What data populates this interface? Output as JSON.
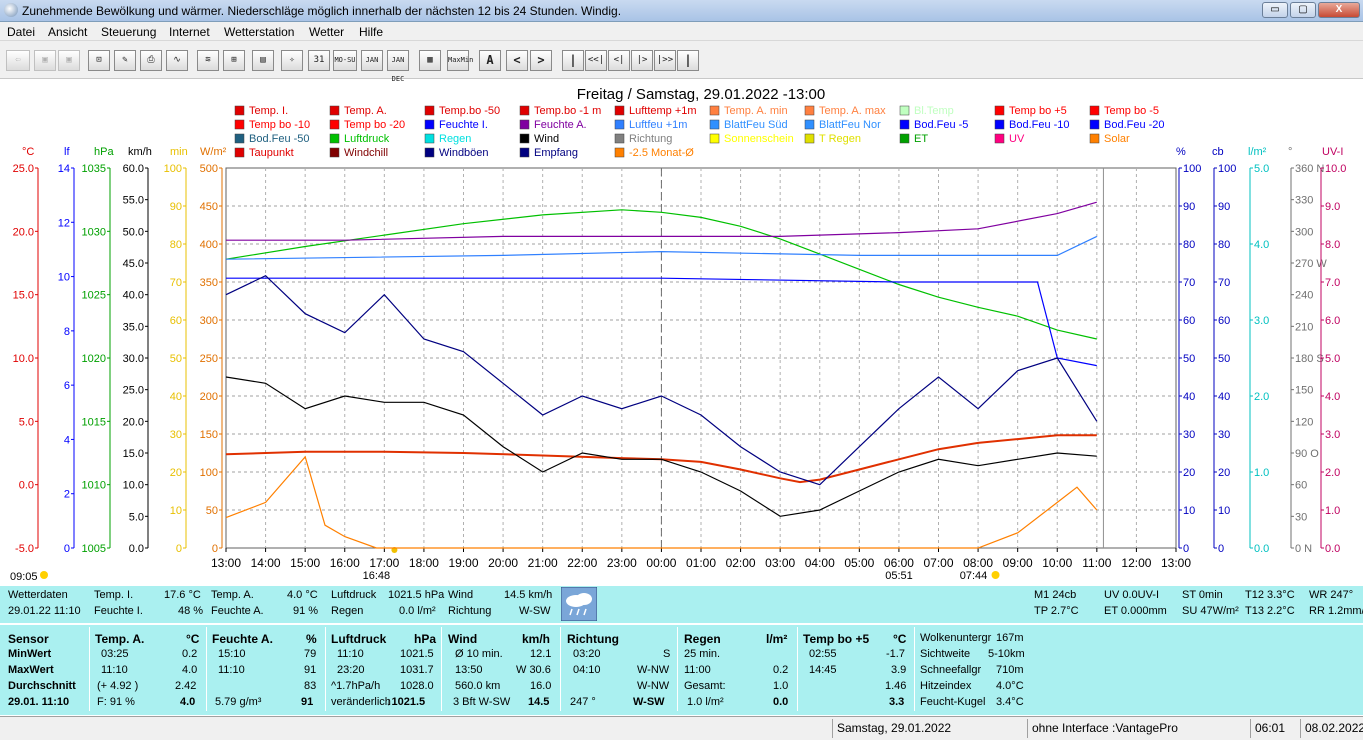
{
  "window": {
    "title": "Zunehmende Bewölkung und wärmer. Niederschläge möglich innerhalb der nächsten 12 bis 24 Stunden. Windig.",
    "buttons": [
      "▭",
      "▢",
      "X"
    ]
  },
  "menu": [
    "Datei",
    "Ansicht",
    "Steuerung",
    "Internet",
    "Wetterstation",
    "Wetter",
    "Hilfe"
  ],
  "toolbar": {
    "buttons": [
      {
        "name": "back",
        "label": "⇦",
        "dim": true
      },
      {
        "name": "save",
        "label": "▣",
        "dim": true
      },
      {
        "name": "save-all",
        "label": "▣",
        "dim": true
      },
      {
        "name": "graph",
        "label": "⊡"
      },
      {
        "name": "notes",
        "label": "✎"
      },
      {
        "name": "print",
        "label": "⎙"
      },
      {
        "name": "curve",
        "label": "∿"
      },
      {
        "name": "chart2",
        "label": "≋"
      },
      {
        "name": "chart3",
        "label": "⊞"
      },
      {
        "name": "doc",
        "label": "▤"
      },
      {
        "name": "compass",
        "label": "✧"
      },
      {
        "name": "day",
        "label": "31"
      },
      {
        "name": "week",
        "label": "MO-SU"
      },
      {
        "name": "month",
        "label": "JAN"
      },
      {
        "name": "year",
        "label": "JAN DEC"
      },
      {
        "name": "table",
        "label": "▦"
      },
      {
        "name": "minmax",
        "label": "MaxMin"
      },
      {
        "name": "auto",
        "label": "A"
      },
      {
        "name": "prev",
        "label": "<"
      },
      {
        "name": "next",
        "label": ">"
      },
      {
        "name": "first",
        "label": "|"
      },
      {
        "name": "rew-fast",
        "label": "<<|"
      },
      {
        "name": "rew",
        "label": "<|"
      },
      {
        "name": "fwd",
        "label": "|>"
      },
      {
        "name": "fwd-fast",
        "label": "|>>"
      },
      {
        "name": "last",
        "label": "|"
      }
    ]
  },
  "chart_data": {
    "type": "line",
    "title": "Freitag / Samstag, 29.01.2022  -13:00",
    "x_ticks": [
      "13:00",
      "14:00",
      "15:00",
      "16:00",
      "17:00",
      "18:00",
      "19:00",
      "20:00",
      "21:00",
      "22:00",
      "23:00",
      "00:00",
      "01:00",
      "02:00",
      "03:00",
      "04:00",
      "05:00",
      "06:00",
      "07:00",
      "08:00",
      "09:00",
      "10:00",
      "11:00",
      "12:00",
      "13:00"
    ],
    "x_markers": {
      "sunset": "16:48",
      "sunrise_twilight": "05:51",
      "sunrise": "07:44",
      "left": "09:05"
    },
    "grid": true,
    "legend_placement": "top",
    "left_axes": [
      {
        "unit": "°C",
        "color": "#e00000",
        "ticks": [
          "25.0",
          "20.0",
          "15.0",
          "10.0",
          "5.0",
          "0.0",
          "-5.0"
        ]
      },
      {
        "unit": "lf",
        "color": "#0000ff",
        "ticks": [
          "14",
          "12",
          "10",
          "8",
          "6",
          "4",
          "2",
          "0"
        ]
      },
      {
        "unit": "hPa",
        "color": "#00a000",
        "ticks": [
          "1035",
          "1030",
          "1025",
          "1020",
          "1015",
          "1010",
          "1005"
        ]
      },
      {
        "unit": "km/h",
        "color": "#000000",
        "ticks": [
          "60.0",
          "55.0",
          "50.0",
          "45.0",
          "40.0",
          "35.0",
          "30.0",
          "25.0",
          "20.0",
          "15.0",
          "10.0",
          "5.0",
          "0.0"
        ]
      },
      {
        "unit": "min",
        "color": "#e8c000",
        "ticks": [
          "100",
          "90",
          "80",
          "70",
          "60",
          "50",
          "40",
          "30",
          "20",
          "10",
          "0"
        ]
      },
      {
        "unit": "W/m²",
        "color": "#e07000",
        "ticks": [
          "500",
          "450",
          "400",
          "350",
          "300",
          "250",
          "200",
          "150",
          "100",
          "50",
          "0"
        ]
      }
    ],
    "right_axes": [
      {
        "unit": "%",
        "color": "#0000c0",
        "ticks": [
          "100",
          "90",
          "80",
          "70",
          "60",
          "50",
          "40",
          "30",
          "20",
          "10",
          "0"
        ]
      },
      {
        "unit": "cb",
        "color": "#0000c0",
        "ticks": [
          "100",
          "90",
          "80",
          "70",
          "60",
          "50",
          "40",
          "30",
          "20",
          "10",
          "0"
        ]
      },
      {
        "unit": "l/m²",
        "color": "#00c0c0",
        "ticks": [
          "5.0",
          "4.0",
          "3.0",
          "2.0",
          "1.0",
          "0.0"
        ]
      },
      {
        "unit": "°",
        "color": "#707070",
        "ticks": [
          "360 N",
          "330",
          "300",
          "270 W",
          "240",
          "210",
          "180 S",
          "150",
          "120",
          "90 O",
          "60",
          "30",
          "0 N"
        ]
      },
      {
        "unit": "UV-I",
        "color": "#c00060",
        "ticks": [
          "10.0",
          "9.0",
          "8.0",
          "7.0",
          "6.0",
          "5.0",
          "4.0",
          "3.0",
          "2.0",
          "1.0",
          "0.0"
        ]
      }
    ],
    "legend": [
      {
        "label": "Temp. I.",
        "color": "#e00000"
      },
      {
        "label": "Temp. A.",
        "color": "#e00000"
      },
      {
        "label": "Temp.bo -50",
        "color": "#e00000"
      },
      {
        "label": "Temp.bo -1 m",
        "color": "#e00000"
      },
      {
        "label": "Lufttemp +1m",
        "color": "#e00000"
      },
      {
        "label": "Temp. A. min",
        "color": "#ff8040"
      },
      {
        "label": "Temp. A. max",
        "color": "#ff8040"
      },
      {
        "label": "Bl.Temp",
        "color": "#c0ffc0"
      },
      {
        "label": "Temp bo +5",
        "color": "#ff0000"
      },
      {
        "label": "Temp bo -5",
        "color": "#ff0000"
      },
      {
        "label": "Temp bo -10",
        "color": "#ff0000"
      },
      {
        "label": "Temp bo -20",
        "color": "#ff0000"
      },
      {
        "label": "Feuchte I.",
        "color": "#0000ff"
      },
      {
        "label": "Feuchte A.",
        "color": "#8000a0"
      },
      {
        "label": "Luftfeu +1m",
        "color": "#3080ff"
      },
      {
        "label": "BlattFeu Süd",
        "color": "#3090ff"
      },
      {
        "label": "BlattFeu Nor",
        "color": "#3090ff"
      },
      {
        "label": "Bod.Feu -5",
        "color": "#0000ff"
      },
      {
        "label": "Bod.Feu -10",
        "color": "#0000ff"
      },
      {
        "label": "Bod.Feu -20",
        "color": "#0000ff"
      },
      {
        "label": "Bod.Feu -50",
        "color": "#206080"
      },
      {
        "label": "Luftdruck",
        "color": "#00c000"
      },
      {
        "label": "Regen",
        "color": "#00e0e0"
      },
      {
        "label": "Wind",
        "color": "#000000"
      },
      {
        "label": "Richtung",
        "color": "#808080"
      },
      {
        "label": "Sonnenschein",
        "color": "#ffff00"
      },
      {
        "label": "T Regen",
        "color": "#e0e000"
      },
      {
        "label": "ET",
        "color": "#00a000"
      },
      {
        "label": "UV",
        "color": "#ff0080"
      },
      {
        "label": "Solar",
        "color": "#ff8000"
      },
      {
        "label": "Taupunkt",
        "color": "#e00000"
      },
      {
        "label": "Windchill",
        "color": "#800000"
      },
      {
        "label": "Windböen",
        "color": "#000080"
      },
      {
        "label": "Empfang",
        "color": "#000080"
      },
      {
        "label": "-2.5 Monat-Ø",
        "color": "#ff8000"
      }
    ],
    "series": [
      {
        "name": "Temp. A.",
        "color": "#e03000",
        "unit": "°C",
        "x": [
          "13:00",
          "15:00",
          "17:00",
          "19:00",
          "21:00",
          "23:00",
          "00:00",
          "01:00",
          "02:00",
          "03:00",
          "03:30",
          "04:00",
          "05:00",
          "06:00",
          "07:00",
          "08:00",
          "09:00",
          "10:00",
          "11:00"
        ],
        "values": [
          2.4,
          2.6,
          2.6,
          2.5,
          2.3,
          2.1,
          2.0,
          1.8,
          1.2,
          0.5,
          0.2,
          0.4,
          1.2,
          2.0,
          2.8,
          3.3,
          3.6,
          3.9,
          3.9
        ]
      },
      {
        "name": "Luftdruck",
        "color": "#00c000",
        "unit": "hPa",
        "x": [
          "13:00",
          "15:00",
          "17:00",
          "19:00",
          "21:00",
          "23:00",
          "00:00",
          "01:00",
          "02:00",
          "03:00",
          "04:00",
          "05:00",
          "06:00",
          "07:00",
          "08:00",
          "09:00",
          "10:00",
          "11:00"
        ],
        "values": [
          1027.8,
          1028.8,
          1029.7,
          1030.6,
          1031.3,
          1031.7,
          1031.5,
          1031.1,
          1030.4,
          1029.4,
          1028.2,
          1027.0,
          1025.8,
          1024.8,
          1024.0,
          1023.3,
          1022.2,
          1021.5
        ]
      },
      {
        "name": "Feuchte A.",
        "color": "#8000a0",
        "unit": "%",
        "x": [
          "13:00",
          "16:00",
          "20:00",
          "00:00",
          "03:00",
          "06:00",
          "08:00",
          "10:00",
          "11:00"
        ],
        "values": [
          81,
          81,
          82,
          82,
          82,
          83,
          84,
          88,
          91
        ]
      },
      {
        "name": "Feuchte I.",
        "color": "#0000ff",
        "unit": "%",
        "x": [
          "13:00",
          "20:00",
          "00:00",
          "06:00",
          "09:30",
          "10:00",
          "11:00"
        ],
        "values": [
          71,
          71,
          71,
          70,
          70,
          50,
          48
        ]
      },
      {
        "name": "Bod.Feu -20",
        "color": "#3080ff",
        "unit": "%",
        "x": [
          "13:00",
          "20:00",
          "00:00",
          "05:00",
          "10:00",
          "11:00"
        ],
        "values": [
          76,
          77,
          78,
          77,
          77,
          82
        ]
      },
      {
        "name": "Wind",
        "color": "#000000",
        "unit": "km/h",
        "x": [
          "13:00",
          "14:00",
          "15:00",
          "16:00",
          "17:00",
          "18:00",
          "19:00",
          "20:00",
          "21:00",
          "22:00",
          "23:00",
          "00:00",
          "01:00",
          "02:00",
          "03:00",
          "04:00",
          "05:00",
          "06:00",
          "07:00",
          "08:00",
          "09:00",
          "10:00",
          "11:00"
        ],
        "values": [
          27,
          26,
          22,
          24,
          23,
          23,
          21,
          16,
          12,
          15,
          14,
          14,
          12,
          9,
          5,
          6,
          9,
          12,
          14,
          13,
          14,
          15,
          14.5
        ]
      },
      {
        "name": "Windböen",
        "color": "#000080",
        "unit": "km/h",
        "x": [
          "13:00",
          "14:00",
          "15:00",
          "16:00",
          "17:00",
          "18:00",
          "19:00",
          "20:00",
          "21:00",
          "22:00",
          "23:00",
          "00:00",
          "01:00",
          "02:00",
          "03:00",
          "04:00",
          "05:00",
          "06:00",
          "07:00",
          "08:00",
          "09:00",
          "10:00",
          "11:00"
        ],
        "values": [
          40,
          43,
          37,
          34,
          40,
          33,
          31,
          26,
          21,
          24,
          22,
          24,
          21,
          16,
          12,
          10,
          16,
          22,
          27,
          22,
          28,
          30,
          20
        ]
      },
      {
        "name": "Solar",
        "color": "#ff8000",
        "unit": "W/m²",
        "x": [
          "13:00",
          "14:00",
          "15:00",
          "15:30",
          "16:00",
          "16:48",
          "08:00",
          "09:00",
          "10:00",
          "10:30",
          "11:00"
        ],
        "values": [
          40,
          60,
          120,
          30,
          15,
          0,
          0,
          20,
          60,
          80,
          50
        ]
      }
    ]
  },
  "infobar": {
    "wetterdaten": "Wetterdaten",
    "datetime": "29.01.22 11:10",
    "temp_i_label": "Temp. I.",
    "temp_i": "17.6 °C",
    "feuchte_i_label": "Feuchte I.",
    "feuchte_i": "48 %",
    "temp_a_label": "Temp. A.",
    "temp_a": "4.0 °C",
    "feuchte_a_label": "Feuchte A.",
    "feuchte_a": "91 %",
    "luftdruck_label": "Luftdruck",
    "luftdruck": "1021.5 hPa",
    "regen_label": "Regen",
    "regen": "0.0 l/m²",
    "wind_label": "Wind",
    "wind": "14.5 km/h",
    "richtung_label": "Richtung",
    "richtung": "W-SW",
    "m1": "M1 24cb",
    "tp": "TP 2.7°C",
    "uv": "UV 0.0UV-I",
    "et": "ET 0.000mm",
    "st": "ST 0min",
    "su": "SU 47W/m²",
    "t12": "T12 3.3°C",
    "t13": "T13 2.2°C",
    "wr": "WR 247°",
    "rr": "RR 1.2mm/h"
  },
  "stats": {
    "sensor": {
      "h": "Sensor",
      "rows": [
        "MinWert",
        "MaxWert",
        "Durchschnitt",
        "29.01. 11:10"
      ]
    },
    "temp_a": {
      "h": "Temp. A.",
      "u": "°C",
      "r1": [
        "03:25",
        "0.2"
      ],
      "r2": [
        "11:10",
        "4.0"
      ],
      "r3": [
        "(+ 4.92 )",
        "2.42"
      ],
      "r4": [
        "F: 91 %",
        "4.0"
      ]
    },
    "feuchte_a": {
      "h": "Feuchte A.",
      "u": "%",
      "r1": [
        "15:10",
        "79"
      ],
      "r2": [
        "11:10",
        "91"
      ],
      "r3": [
        "",
        "83"
      ],
      "r4": [
        "5.79 g/m³",
        "91"
      ]
    },
    "luftdruck": {
      "h": "Luftdruck",
      "u": "hPa",
      "r1": [
        "11:10",
        "1021.5"
      ],
      "r2": [
        "23:20",
        "1031.7"
      ],
      "r3": [
        "^1.7hPa/h",
        "1028.0"
      ],
      "r4": [
        "veränderlich",
        "↓1021.5"
      ]
    },
    "wind": {
      "h": "Wind",
      "u": "km/h",
      "r1": [
        "Ø 10 min.",
        "12.1"
      ],
      "r2": [
        "13:50",
        "W 30.6"
      ],
      "r3": [
        "560.0 km",
        "16.0"
      ],
      "r4": [
        "3 Bft W-SW",
        "14.5"
      ]
    },
    "richtung": {
      "h": "Richtung",
      "r1": [
        "03:20",
        "S"
      ],
      "r2": [
        "04:10",
        "W-NW"
      ],
      "r3": [
        "",
        "W-NW"
      ],
      "r4": [
        "247 °",
        "W-SW"
      ]
    },
    "regen": {
      "h": "Regen",
      "u": "l/m²",
      "r1": [
        "25 min.",
        ""
      ],
      "r2": [
        "11:00",
        "0.2"
      ],
      "r3": [
        "Gesamt:",
        "1.0"
      ],
      "r4": [
        "1.0 l/m²",
        "0.0"
      ]
    },
    "tempbo": {
      "h": "Temp bo +5",
      "u": "°C",
      "r1": [
        "02:55",
        "-1.7"
      ],
      "r2": [
        "14:45",
        "3.9"
      ],
      "r3": [
        "",
        "1.46"
      ],
      "r4": [
        "",
        "3.3"
      ]
    },
    "extra": [
      [
        "Wolkenuntergr",
        "167m"
      ],
      [
        "Sichtweite",
        "5-10km"
      ],
      [
        "Schneefallgr",
        "710m"
      ],
      [
        "Hitzeindex",
        "4.0°C"
      ],
      [
        "Feucht-Kugel",
        "3.4°C"
      ]
    ]
  },
  "statusbar": {
    "date": "Samstag, 29.01.2022",
    "interface": "ohne Interface :VantagePro",
    "time": "06:01",
    "today": "08.02.2022"
  }
}
